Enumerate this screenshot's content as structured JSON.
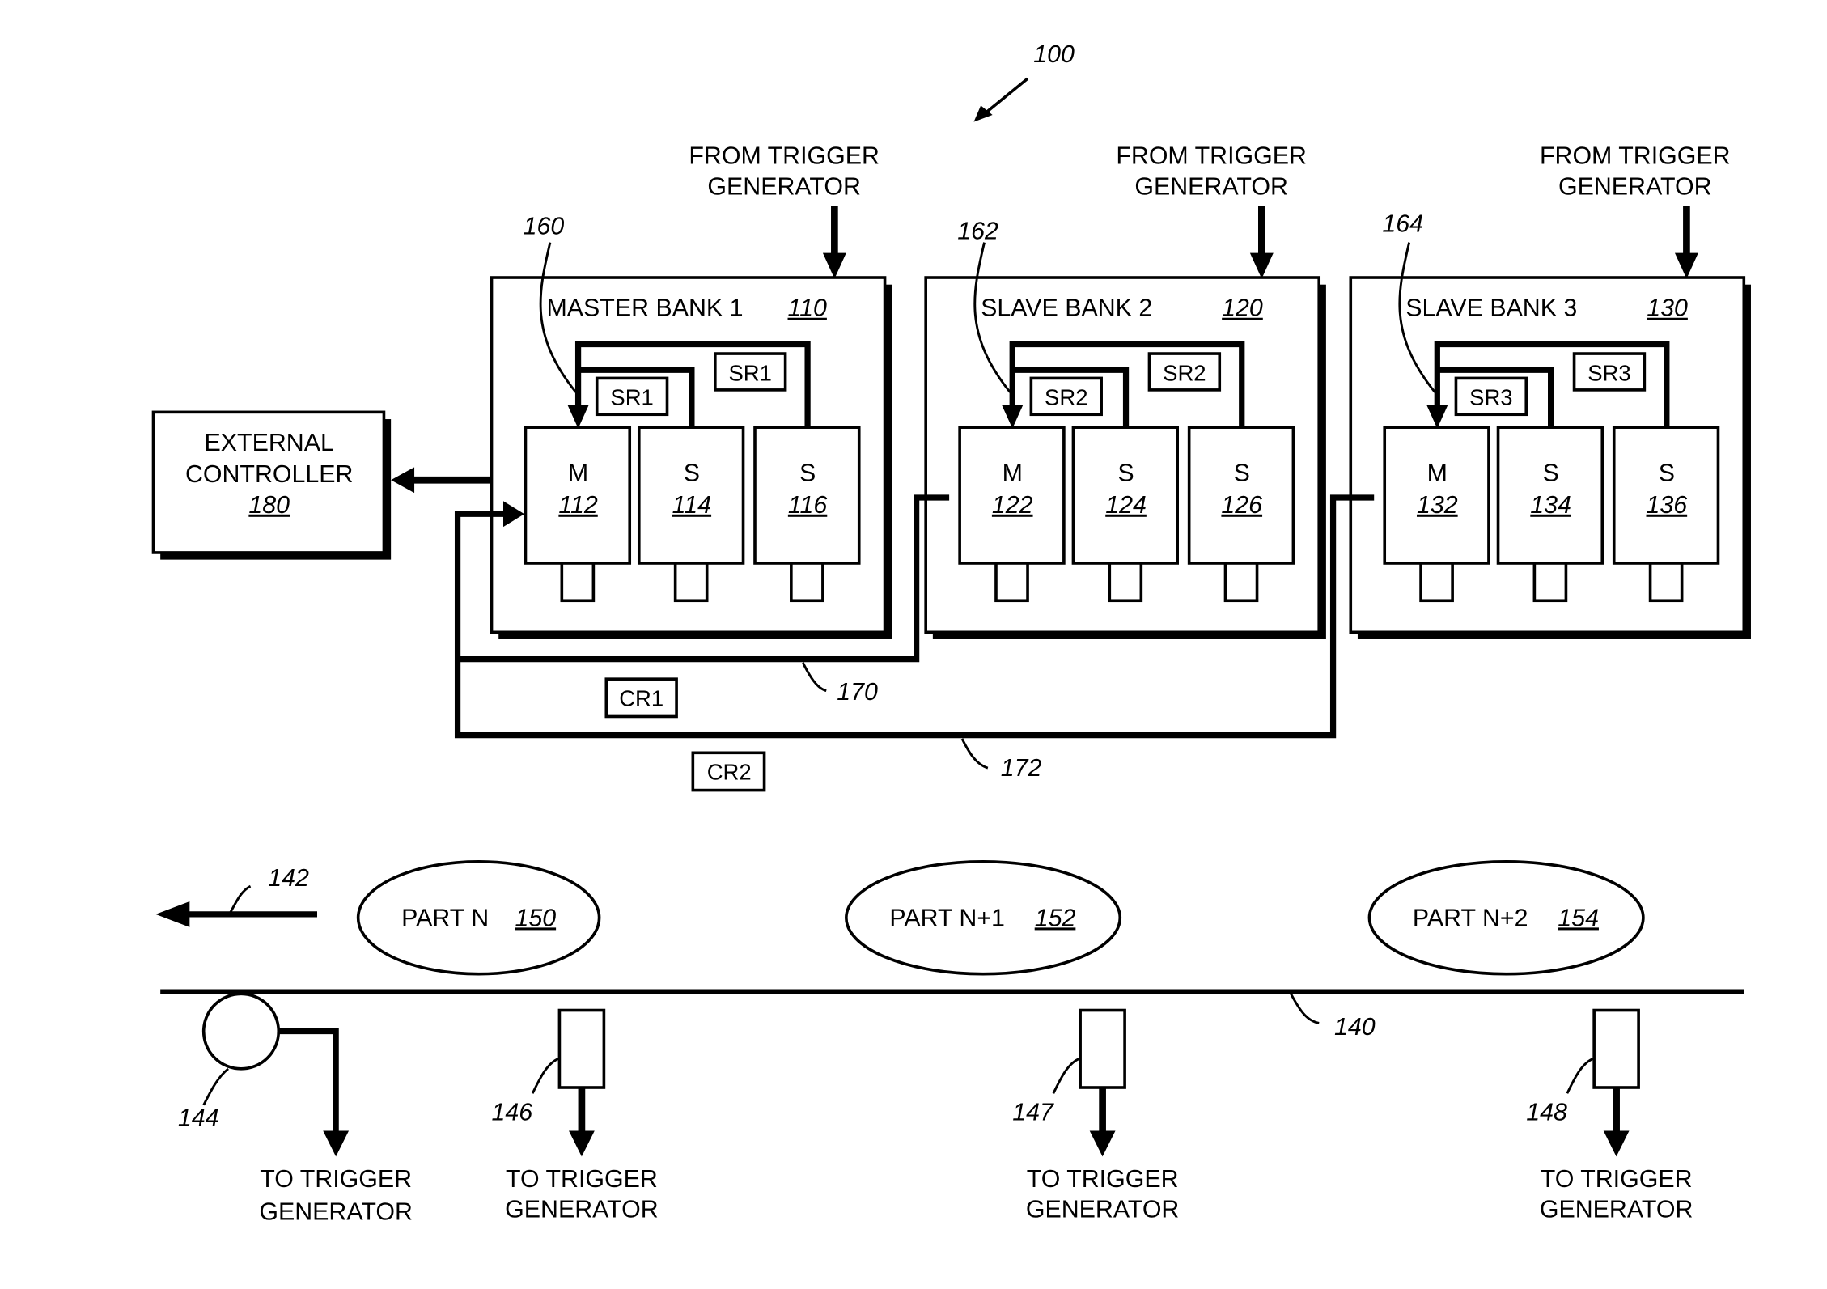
{
  "figure": {
    "ref": "100",
    "external_controller": {
      "line1": "EXTERNAL",
      "line2": "CONTROLLER",
      "ref": "180"
    },
    "trigger_input_label": {
      "line1": "FROM TRIGGER",
      "line2": "GENERATOR"
    },
    "trigger_output_label": {
      "line1": "TO TRIGGER",
      "line2": "GENERATOR"
    },
    "banks": [
      {
        "title": "MASTER BANK 1",
        "ref": "110",
        "leader_ref": "160",
        "sr": "SR1",
        "cameras": [
          {
            "role": "M",
            "ref": "112"
          },
          {
            "role": "S",
            "ref": "114"
          },
          {
            "role": "S",
            "ref": "116"
          }
        ]
      },
      {
        "title": "SLAVE BANK 2",
        "ref": "120",
        "leader_ref": "162",
        "sr": "SR2",
        "cameras": [
          {
            "role": "M",
            "ref": "122"
          },
          {
            "role": "S",
            "ref": "124"
          },
          {
            "role": "S",
            "ref": "126"
          }
        ]
      },
      {
        "title": "SLAVE BANK 3",
        "ref": "130",
        "leader_ref": "164",
        "sr": "SR3",
        "cameras": [
          {
            "role": "M",
            "ref": "132"
          },
          {
            "role": "S",
            "ref": "134"
          },
          {
            "role": "S",
            "ref": "136"
          }
        ]
      }
    ],
    "connections": [
      {
        "label": "CR1",
        "ref": "170"
      },
      {
        "label": "CR2",
        "ref": "172"
      }
    ],
    "conveyor": {
      "ref": "140",
      "direction_ref": "142",
      "encoder_ref": "144",
      "sensor_refs": [
        "146",
        "147",
        "148"
      ],
      "parts": [
        {
          "label": "PART N",
          "ref": "150"
        },
        {
          "label": "PART N+1",
          "ref": "152"
        },
        {
          "label": "PART N+2",
          "ref": "154"
        }
      ]
    }
  }
}
